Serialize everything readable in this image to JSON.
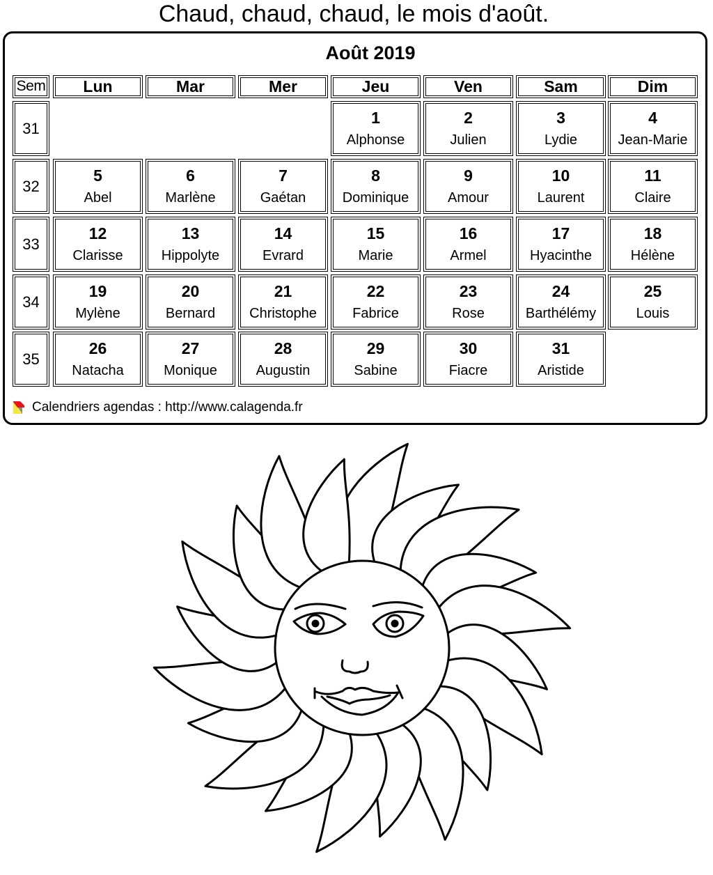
{
  "page": {
    "title": "Chaud, chaud, chaud, le mois d'août."
  },
  "calendar": {
    "month_title": "Août 2019",
    "week_header": "Sem",
    "day_headers": [
      "Lun",
      "Mar",
      "Mer",
      "Jeu",
      "Ven",
      "Sam",
      "Dim"
    ],
    "weeks": [
      {
        "number": "31",
        "days": [
          null,
          null,
          null,
          {
            "day": "1",
            "name": "Alphonse"
          },
          {
            "day": "2",
            "name": "Julien"
          },
          {
            "day": "3",
            "name": "Lydie"
          },
          {
            "day": "4",
            "name": "Jean-Marie"
          }
        ]
      },
      {
        "number": "32",
        "days": [
          {
            "day": "5",
            "name": "Abel"
          },
          {
            "day": "6",
            "name": "Marlène"
          },
          {
            "day": "7",
            "name": "Gaétan"
          },
          {
            "day": "8",
            "name": "Dominique"
          },
          {
            "day": "9",
            "name": "Amour"
          },
          {
            "day": "10",
            "name": "Laurent"
          },
          {
            "day": "11",
            "name": "Claire"
          }
        ]
      },
      {
        "number": "33",
        "days": [
          {
            "day": "12",
            "name": "Clarisse"
          },
          {
            "day": "13",
            "name": "Hippolyte"
          },
          {
            "day": "14",
            "name": "Evrard"
          },
          {
            "day": "15",
            "name": "Marie"
          },
          {
            "day": "16",
            "name": "Armel"
          },
          {
            "day": "17",
            "name": "Hyacinthe"
          },
          {
            "day": "18",
            "name": "Hélène"
          }
        ]
      },
      {
        "number": "34",
        "days": [
          {
            "day": "19",
            "name": "Mylène"
          },
          {
            "day": "20",
            "name": "Bernard"
          },
          {
            "day": "21",
            "name": "Christophe"
          },
          {
            "day": "22",
            "name": "Fabrice"
          },
          {
            "day": "23",
            "name": "Rose"
          },
          {
            "day": "24",
            "name": "Barthélémy"
          },
          {
            "day": "25",
            "name": "Louis"
          }
        ]
      },
      {
        "number": "35",
        "days": [
          {
            "day": "26",
            "name": "Natacha"
          },
          {
            "day": "27",
            "name": "Monique"
          },
          {
            "day": "28",
            "name": "Augustin"
          },
          {
            "day": "29",
            "name": "Sabine"
          },
          {
            "day": "30",
            "name": "Fiacre"
          },
          {
            "day": "31",
            "name": "Aristide"
          },
          null
        ]
      }
    ]
  },
  "footer": {
    "icon": "calagenda-logo-icon",
    "text": "Calendriers agendas : http://www.calagenda.fr",
    "logo_colors": {
      "red": "#e8141c",
      "yellow": "#f5e640",
      "gray": "#8a8a80"
    }
  },
  "illustration": {
    "subject": "smiling-sun-coloring-drawing"
  }
}
